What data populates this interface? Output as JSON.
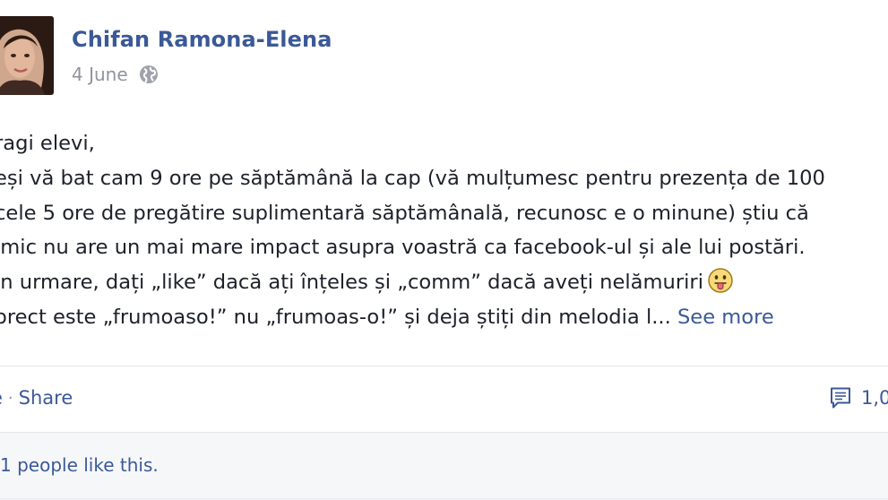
{
  "post": {
    "author": "Chifan Ramona-Elena",
    "date": "4 June",
    "privacy_icon": "globe-icon",
    "lines": [
      "ragi elevi,",
      "eși vă bat cam 9 ore pe săptămână la cap (vă mulțumesc pentru prezența de 100",
      " cele 5 ore de pregătire suplimentară săptămânală, recunosc e o minune) știu că",
      "imic nu are un mai mare impact asupra voastră ca facebook-ul și ale lui postări.",
      "in urmare, dați „like” dacă ați înțeles și „comm” dacă aveți nelămuriri",
      "orect este „frumoaso!” nu „frumoas-o!” și deja știți din melodia l..."
    ],
    "emoji": "tongue-out-emoji",
    "see_more": "See more"
  },
  "actions": {
    "like_label": "e",
    "separator": "·",
    "share_label": "Share",
    "comment_count": "1,0"
  },
  "likes": {
    "text": "1 people like this."
  },
  "colors": {
    "link": "#3b5998",
    "text": "#1d2129",
    "meta": "#90949c",
    "footer_bg": "#f6f7f9"
  }
}
